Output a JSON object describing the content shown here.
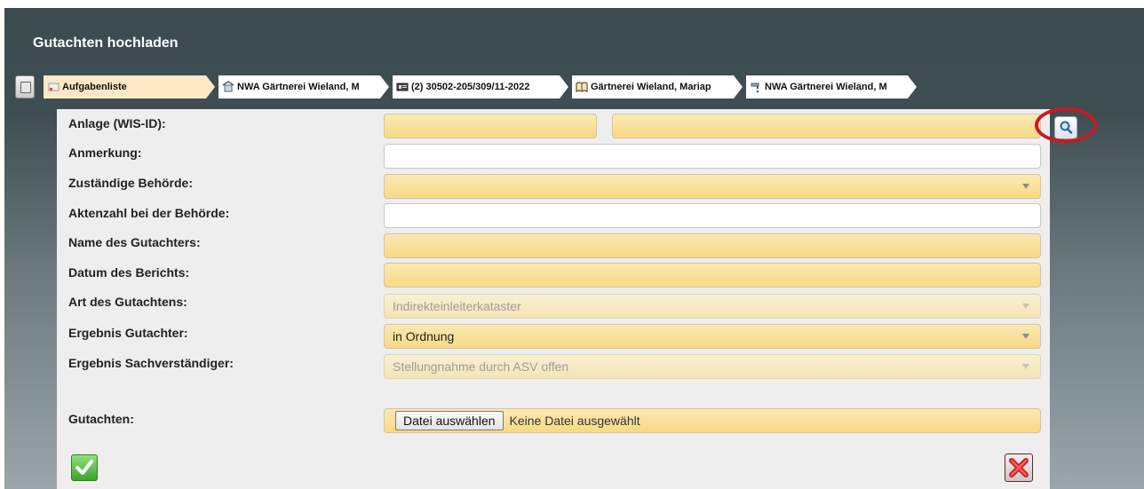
{
  "window": {
    "title": "Gutachten hochladen"
  },
  "breadcrumbs": [
    {
      "label": "Aufgabenliste",
      "icon": "task-list-icon"
    },
    {
      "label": "NWA Gärtnerei Wieland, M",
      "icon": "facility-icon"
    },
    {
      "label": "(2) 30502-205/309/11-2022",
      "icon": "id-card-icon"
    },
    {
      "label": "Gärtnerei Wieland, Mariap",
      "icon": "book-icon"
    },
    {
      "label": "NWA Gärtnerei Wieland, M",
      "icon": "tap-icon"
    }
  ],
  "form": {
    "anlage": {
      "label": "Anlage (WIS-ID):",
      "value1": "",
      "value2": ""
    },
    "anmerkung": {
      "label": "Anmerkung:",
      "value": ""
    },
    "behoerde": {
      "label": "Zuständige Behörde:",
      "value": ""
    },
    "aktenzahl": {
      "label": "Aktenzahl bei der Behörde:",
      "value": ""
    },
    "gutachter": {
      "label": "Name des Gutachters:",
      "value": ""
    },
    "datum": {
      "label": "Datum des Berichts:",
      "value": ""
    },
    "art": {
      "label": "Art des Gutachtens:",
      "value": "Indirekteinleiterkataster"
    },
    "ergebnis_gutachter": {
      "label": "Ergebnis Gutachter:",
      "value": "in Ordnung"
    },
    "ergebnis_sv": {
      "label": "Ergebnis Sachverständiger:",
      "value": "Stellungnahme durch ASV offen"
    },
    "gutachten": {
      "label": "Gutachten:",
      "button_label": "Datei auswählen",
      "status": "Keine Datei ausgewählt"
    }
  },
  "actions": {
    "confirm_icon": "checkmark-icon",
    "cancel_icon": "x-icon",
    "search_icon": "magnifier-icon"
  },
  "colors": {
    "header": "#3e4e53",
    "field": "#f8d985",
    "active_crumb": "#fde8c6",
    "highlight_circle": "#c51c23"
  }
}
